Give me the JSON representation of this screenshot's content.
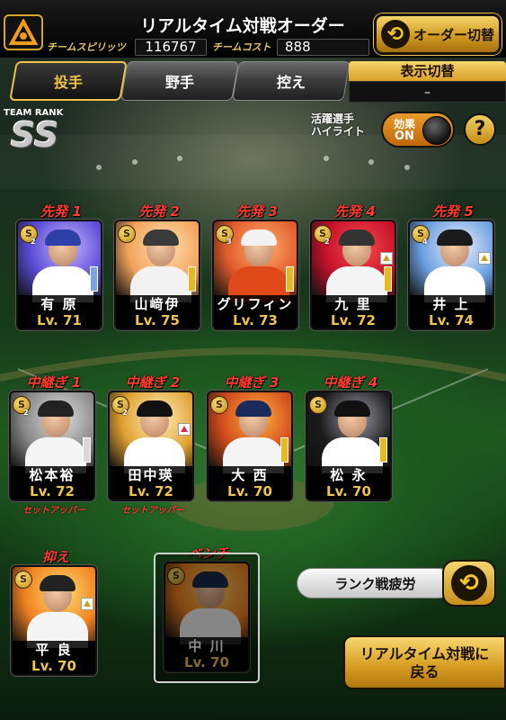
{
  "header": {
    "title": "リアルタイム対戦オーダー",
    "team_spirits_label": "チームスピリッツ",
    "team_spirits_value": "116767",
    "team_cost_label": "チームコスト",
    "team_cost_value": "888",
    "order_switch_label": "オーダー切替"
  },
  "tabs": [
    {
      "label": "投手",
      "active": true
    },
    {
      "label": "野手",
      "active": false
    },
    {
      "label": "控え",
      "active": false
    }
  ],
  "display_switch": {
    "title": "表示切替",
    "value": "–"
  },
  "team_rank": {
    "label": "TEAM RANK",
    "value": "SS"
  },
  "highlight": {
    "label_line1": "活躍選手",
    "label_line2": "ハイライト",
    "toggle_line1": "効果",
    "toggle_line2": "ON",
    "help": "?"
  },
  "starters": [
    {
      "role": "先発 1",
      "name": "有 原",
      "level": "Lv. 71",
      "badge": "2",
      "bar": "#79a6e0",
      "arrow": ""
    },
    {
      "role": "先発 2",
      "name": "山﨑伊",
      "level": "Lv. 75",
      "badge": "",
      "bar": "#e8b820",
      "arrow": ""
    },
    {
      "role": "先発 3",
      "name": "グリフィン",
      "level": "Lv. 73",
      "badge": "3",
      "bar": "#e8b820",
      "arrow": ""
    },
    {
      "role": "先発 4",
      "name": "九 里",
      "level": "Lv. 72",
      "badge": "2",
      "bar": "#e8b820",
      "arrow": "gold"
    },
    {
      "role": "先発 5",
      "name": "井 上",
      "level": "Lv. 74",
      "badge": "4",
      "bar": "",
      "arrow": "gold"
    }
  ],
  "relievers": [
    {
      "role": "中継ぎ 1",
      "name": "松本裕",
      "level": "Lv. 72",
      "badge": "2",
      "bar": "#d9d9d9",
      "arrow": "",
      "note": "セットアッパー"
    },
    {
      "role": "中継ぎ 2",
      "name": "田中瑛",
      "level": "Lv. 72",
      "badge": "2",
      "bar": "",
      "arrow": "red",
      "note": "セットアッパー"
    },
    {
      "role": "中継ぎ 3",
      "name": "大 西",
      "level": "Lv. 70",
      "badge": "",
      "bar": "#e8b820",
      "arrow": "",
      "note": ""
    },
    {
      "role": "中継ぎ 4",
      "name": "松 永",
      "level": "Lv. 70",
      "badge": "",
      "bar": "#e8b820",
      "arrow": "",
      "note": ""
    }
  ],
  "closer": {
    "role": "抑え",
    "name": "平 良",
    "level": "Lv. 70",
    "badge": "",
    "arrow": "gold"
  },
  "bench": {
    "role": "ベンチ",
    "name": "中 川",
    "level": "Lv. 70",
    "badge": ""
  },
  "rank_fatigue_label": "ランク戦疲労",
  "back_button": {
    "line1": "リアルタイム対戦に",
    "line2": "戻る"
  },
  "colors": {
    "accent_gold": "#f0c34a",
    "role_red": "#ff3b2f"
  }
}
